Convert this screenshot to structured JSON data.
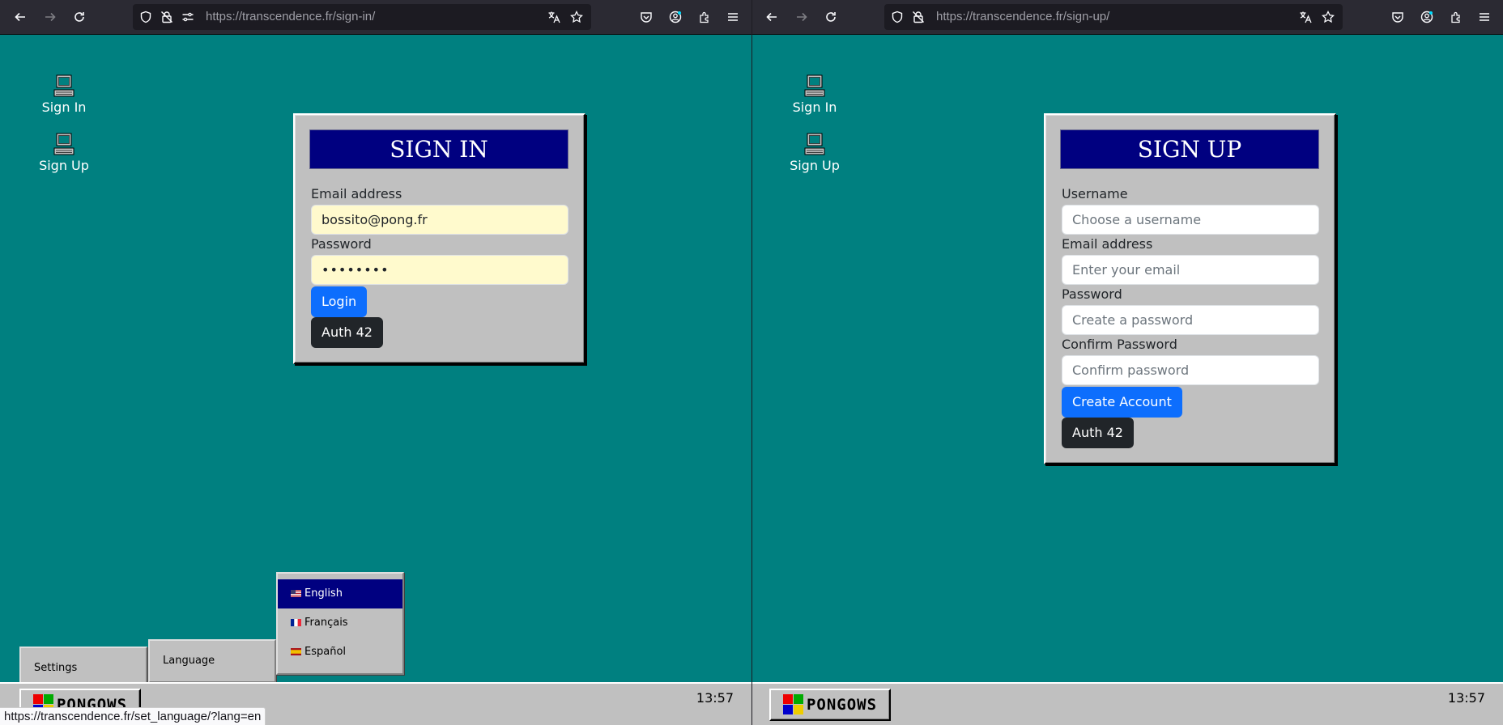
{
  "left": {
    "url": {
      "host": "https://transcendence.fr",
      "path": "/sign-in/"
    },
    "desktop_icons": [
      "Sign In",
      "Sign Up"
    ],
    "form": {
      "title": "SIGN IN",
      "email_label": "Email address",
      "email_value": "bossito@pong.fr",
      "password_label": "Password",
      "password_value": "••••••••",
      "login_button": "Login",
      "auth_button": "Auth 42"
    },
    "start_menu": {
      "settings": "Settings",
      "language": "Language",
      "languages": [
        {
          "label": "English",
          "flag": "us-flag-icon",
          "active": true
        },
        {
          "label": "Français",
          "flag": "fr-flag-icon",
          "active": false
        },
        {
          "label": "Español",
          "flag": "es-flag-icon",
          "active": false
        }
      ]
    },
    "taskbar": {
      "brand": "PONGOWS",
      "clock": "13:57"
    },
    "status_url": "https://transcendence.fr/set_language/?lang=en"
  },
  "right": {
    "url": {
      "host": "https://transcendence.fr",
      "path": "/sign-up/"
    },
    "desktop_icons": [
      "Sign In",
      "Sign Up"
    ],
    "form": {
      "title": "SIGN UP",
      "username_label": "Username",
      "username_placeholder": "Choose a username",
      "email_label": "Email address",
      "email_placeholder": "Enter your email",
      "password_label": "Password",
      "password_placeholder": "Create a password",
      "confirm_label": "Confirm Password",
      "confirm_placeholder": "Confirm password",
      "create_button": "Create Account",
      "auth_button": "Auth 42"
    },
    "taskbar": {
      "brand": "PONGOWS",
      "clock": "13:57"
    }
  },
  "colors": {
    "desktop": "#008080",
    "panel": "#c0c0c0",
    "title_bar": "#000080",
    "primary": "#0d6efd",
    "dark": "#212529",
    "autofill": "#fffacd"
  }
}
